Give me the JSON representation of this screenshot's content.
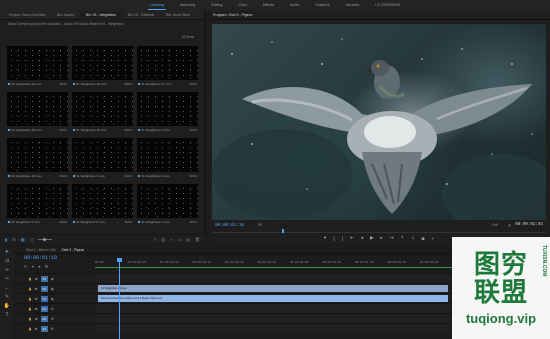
{
  "workspaces": [
    "Learning",
    "Assembly",
    "Editing",
    "Color",
    "Effects",
    "Audio",
    "Graphics",
    "Libraries",
    "LS OVERVIEW"
  ],
  "active_workspace": "Learning",
  "project": {
    "tabs": [
      "Project: Snow Overview",
      "Bin: Assets",
      "Bin: 03 - Weightless",
      "Bin: 02 - Ethereal",
      "Bin: Snow Work"
    ],
    "active_tab": "Bin: 03 - Weightless",
    "path": "Snow Overview.prproj/Lens Distortion - Snow VFX/Snow Weather/03 - Weightless",
    "count": "20 Items",
    "clips": [
      {
        "name": "SL Weightless 11.mov",
        "duration": "10:01"
      },
      {
        "name": "SL Weightless 16.mov",
        "duration": "10:01"
      },
      {
        "name": "SL Weightless 17.mov",
        "duration": "10:01"
      },
      {
        "name": "SL Weightless 18.mov",
        "duration": "10:01"
      },
      {
        "name": "SL Weightless 19.mov",
        "duration": "10:01"
      },
      {
        "name": "SL Weightless 2.mov",
        "duration": "10:01"
      },
      {
        "name": "SL Weightless 20.mov",
        "duration": "10:01"
      },
      {
        "name": "SL Weightless 3.mov",
        "duration": "10:01"
      },
      {
        "name": "SL Weightless 4.mov",
        "duration": "10:01"
      },
      {
        "name": "SL Weightless 5.mov",
        "duration": "10:01"
      },
      {
        "name": "SL Weightless 6.mov",
        "duration": "10:01"
      },
      {
        "name": "SL Weightless 7.mov",
        "duration": "10:01"
      }
    ]
  },
  "program": {
    "title": "Program: Shot 3 - Pigeon",
    "timecode": "00:00:01:18",
    "fit": "Fit",
    "full": "Full",
    "duration": "00:00:02:03",
    "playhead_fraction": 0.21
  },
  "timeline": {
    "tabs": [
      "Shot 1 - Alice in City",
      "Shot 3 - Pigeon"
    ],
    "active_tab": "Shot 3 - Pigeon",
    "timecode": "00:00:01:18",
    "ruler": [
      "00:00",
      "00:00:00:05",
      "00:00:00:10",
      "00:00:00:15",
      "00:00:00:20",
      "00:00:01:00",
      "00:00:01:05",
      "00:00:01:10",
      "00:00:01:15",
      "00:00:01:20",
      "00:00:02:00",
      "00:00:02:05",
      "00:00:02:10",
      "00:00:02:15"
    ],
    "tracks": [
      {
        "label": "V3",
        "target": "V3"
      },
      {
        "label": "V2",
        "target": "V2"
      },
      {
        "label": "V1",
        "target": "V1"
      },
      {
        "label": "A1",
        "target": "A1"
      },
      {
        "label": "A2",
        "target": "A2"
      },
      {
        "label": "A3",
        "target": "A3"
      }
    ],
    "clips": [
      {
        "label": "SL Weightless 14.mov",
        "track": "V2"
      },
      {
        "label": "Snow Overview Lens Edit Lens 3.4 Pigeon Shot.mp4",
        "track": "V1"
      }
    ]
  },
  "watermark": {
    "cn": "图穷联盟",
    "url": "tuqiong.vip",
    "side": "TUXISN.COM"
  }
}
